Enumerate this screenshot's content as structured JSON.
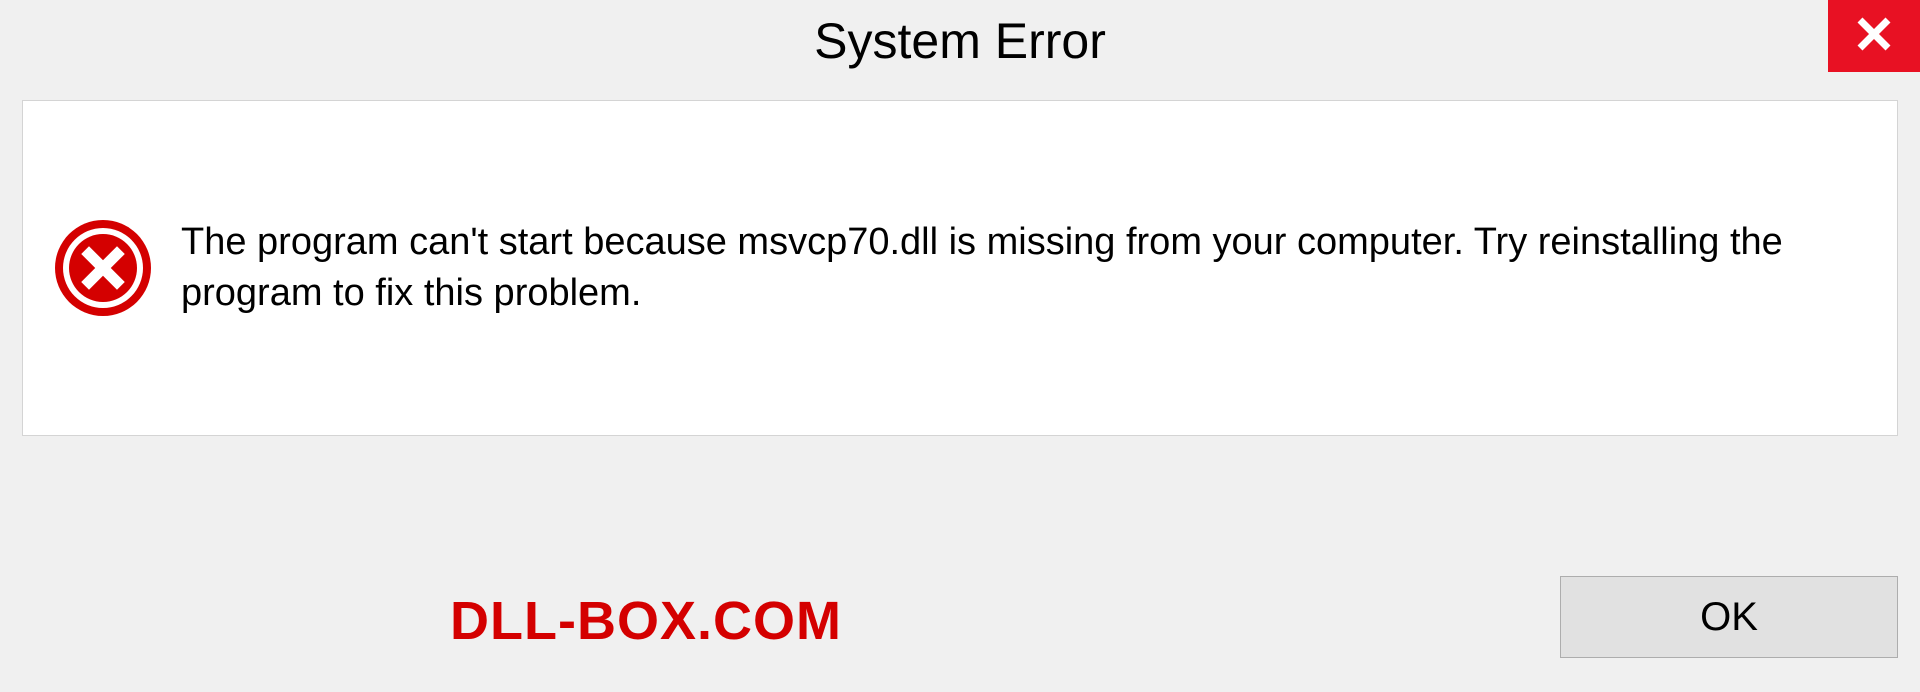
{
  "title": "System Error",
  "message": "The program can't start because msvcp70.dll is missing from your computer. Try reinstalling the program to fix this problem.",
  "ok_label": "OK",
  "branding": "DLL-BOX.COM"
}
